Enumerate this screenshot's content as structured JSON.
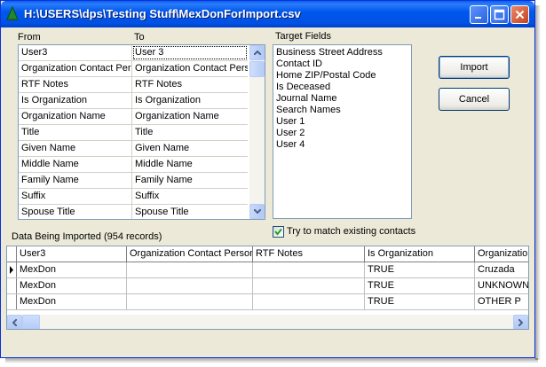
{
  "window": {
    "title": "H:\\USERS\\dps\\Testing Stuff\\MexDonForImport.csv"
  },
  "mapping": {
    "from_header": "From",
    "to_header": "To",
    "rows": [
      {
        "from": "User3",
        "to": "User 3"
      },
      {
        "from": "Organization Contact Person",
        "to": "Organization Contact Person"
      },
      {
        "from": "RTF Notes",
        "to": "RTF Notes"
      },
      {
        "from": "Is Organization",
        "to": "Is Organization"
      },
      {
        "from": "Organization Name",
        "to": "Organization Name"
      },
      {
        "from": "Title",
        "to": "Title"
      },
      {
        "from": "Given Name",
        "to": "Given Name"
      },
      {
        "from": "Middle Name",
        "to": "Middle Name"
      },
      {
        "from": "Family Name",
        "to": "Family Name"
      },
      {
        "from": "Suffix",
        "to": "Suffix"
      },
      {
        "from": "Spouse Title",
        "to": "Spouse Title"
      }
    ]
  },
  "target_fields": {
    "label": "Target Fields",
    "items": [
      "Business Street Address",
      "Contact ID",
      "Home ZIP/Postal Code",
      "Is Deceased",
      "Journal Name",
      "Search Names",
      "User 1",
      "User 2",
      "User 4"
    ]
  },
  "buttons": {
    "import": "Import",
    "cancel": "Cancel"
  },
  "match_checkbox": {
    "label": "Try to match existing contacts",
    "checked": true
  },
  "imported": {
    "label": "Data Being Imported (954 records)",
    "columns": [
      "User3",
      "Organization Contact Person",
      "RTF Notes",
      "Is Organization",
      "Organization"
    ],
    "rows": [
      [
        "MexDon",
        "",
        "",
        "TRUE",
        "Cruzada"
      ],
      [
        "MexDon",
        "",
        "",
        "TRUE",
        "UNKNOWN"
      ],
      [
        "MexDon",
        "",
        "",
        "TRUE",
        "OTHER P"
      ]
    ]
  }
}
